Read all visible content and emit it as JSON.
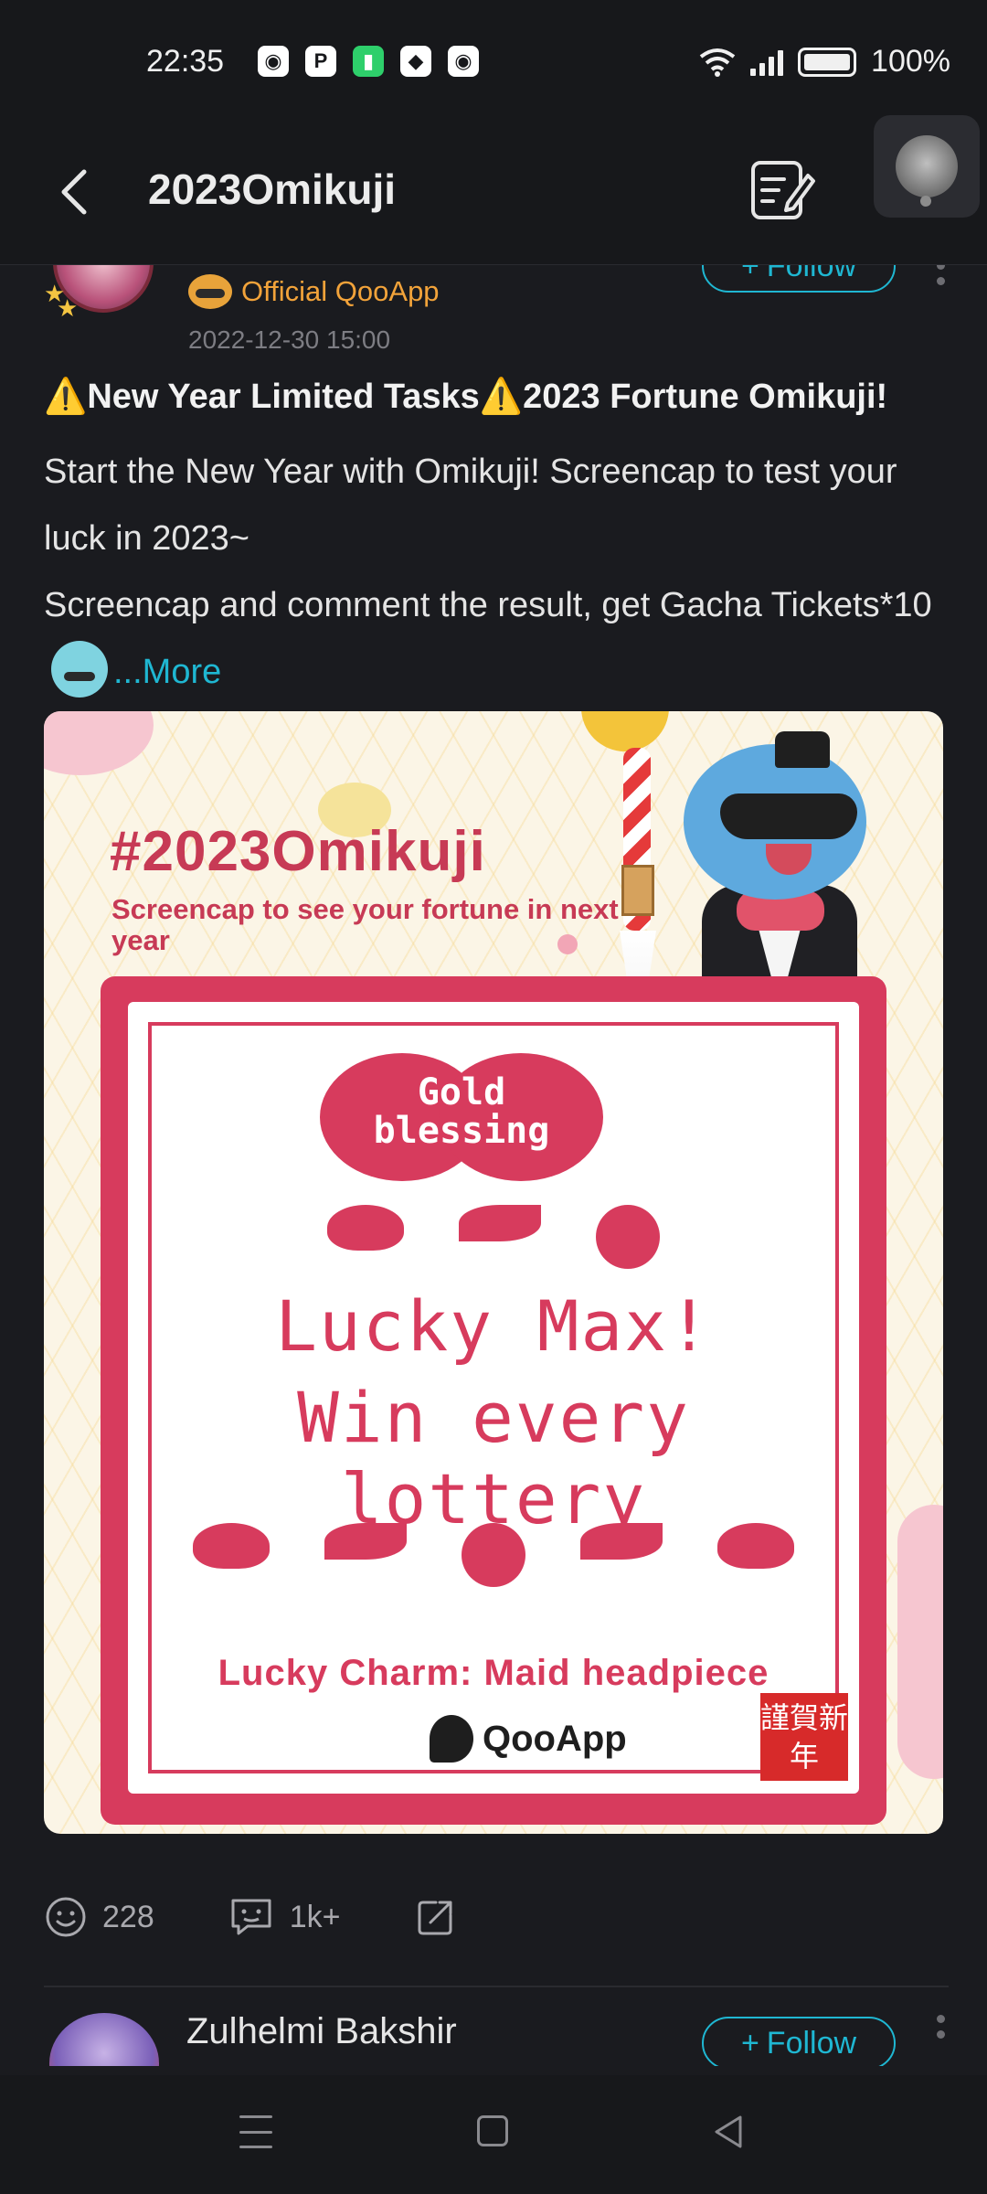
{
  "status": {
    "time": "22:35",
    "battery": "100%",
    "icons": [
      "discord-icon",
      "pinterest-icon",
      "battery-saver-icon",
      "app-icon",
      "discord-icon"
    ]
  },
  "appbar": {
    "title": "2023Omikuji"
  },
  "post": {
    "badge": "Official QooApp",
    "date": "2022-12-30 15:00",
    "follow_label": "Follow",
    "title": "⚠️New Year Limited Tasks⚠️2023 Fortune Omikuji!",
    "line1": "Start the New Year with Omikuji! Screencap to test your luck in 2023~",
    "line2": "Screencap and comment the result, get Gacha Tickets*10",
    "more": "...More",
    "image": {
      "hashtag": "#2023Omikuji",
      "subtitle": "Screencap to see your fortune in next year",
      "blessing": "Gold blessing",
      "lucky_line1": "Lucky Max!",
      "lucky_line2": "Win every lottery",
      "charm": "Lucky Charm: Maid headpiece",
      "brand": "QooApp",
      "stamp": "謹賀新年"
    },
    "reactions": "228",
    "comments": "1k+"
  },
  "next_post": {
    "username": "Zulhelmi Bakshir",
    "follow_label": "Follow"
  }
}
